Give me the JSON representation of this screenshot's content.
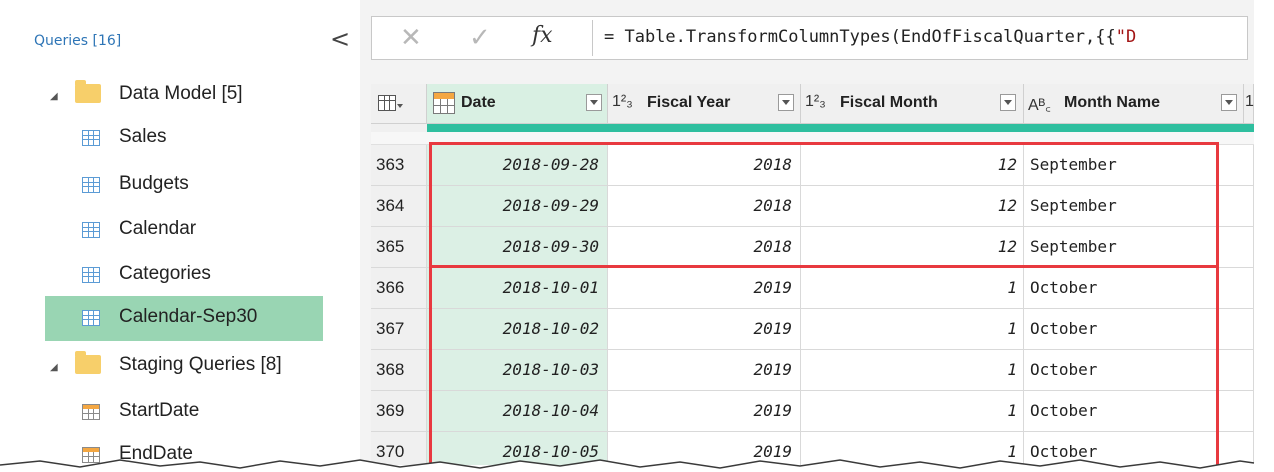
{
  "queries_pane": {
    "header": "Queries [16]",
    "collapse_glyph": "<",
    "groups": [
      {
        "label": "Data Model [5]",
        "items": [
          "Sales",
          "Budgets",
          "Calendar",
          "Categories",
          "Calendar-Sep30"
        ],
        "selected_item": "Calendar-Sep30"
      },
      {
        "label": "Staging Queries [8]",
        "items": [
          "StartDate",
          "EndDate"
        ]
      }
    ]
  },
  "formula_bar": {
    "cancel_glyph": "✕",
    "commit_glyph": "✓",
    "fx_glyph": "fx",
    "formula_prefix": "= Table.TransformColumnTypes(EndOfFiscalQuarter,{{",
    "formula_tail": "\"D"
  },
  "grid": {
    "columns": [
      {
        "type_glyph": "",
        "label": "Date"
      },
      {
        "type_glyph": "1²₃",
        "label": "Fiscal Year"
      },
      {
        "type_glyph": "1²₃",
        "label": "Fiscal Month"
      },
      {
        "type_glyph": "Aᴮ꜀",
        "label": "Month Name"
      }
    ],
    "next_column_glyph": "1",
    "rows": [
      {
        "n": "363",
        "date": "2018-09-28",
        "fy": "2018",
        "fm": "12",
        "month": "September"
      },
      {
        "n": "364",
        "date": "2018-09-29",
        "fy": "2018",
        "fm": "12",
        "month": "September"
      },
      {
        "n": "365",
        "date": "2018-09-30",
        "fy": "2018",
        "fm": "12",
        "month": "September"
      },
      {
        "n": "366",
        "date": "2018-10-01",
        "fy": "2019",
        "fm": "1",
        "month": "October"
      },
      {
        "n": "367",
        "date": "2018-10-02",
        "fy": "2019",
        "fm": "1",
        "month": "October"
      },
      {
        "n": "368",
        "date": "2018-10-03",
        "fy": "2019",
        "fm": "1",
        "month": "October"
      },
      {
        "n": "369",
        "date": "2018-10-04",
        "fy": "2019",
        "fm": "1",
        "month": "October"
      },
      {
        "n": "370",
        "date": "2018-10-05",
        "fy": "2019",
        "fm": "1",
        "month": "October"
      }
    ]
  },
  "colors": {
    "accent_blue": "#2e75b6",
    "selection_green": "#99d5b3",
    "date_column": "#dcf0e5",
    "quality_bar": "#2fbf9f",
    "highlight_red": "#e8393f",
    "folder_yellow": "#f7cf6a"
  }
}
